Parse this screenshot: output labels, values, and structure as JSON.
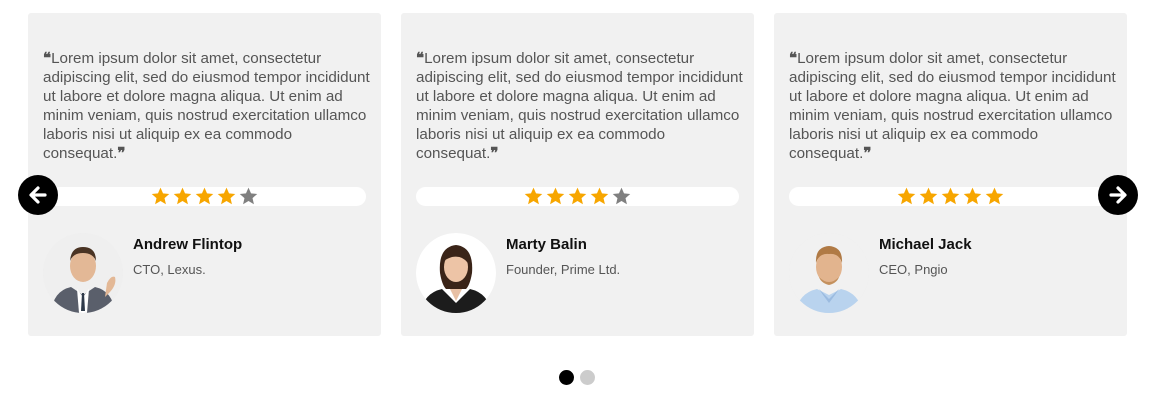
{
  "testimonials": [
    {
      "quote": "Lorem ipsum dolor sit amet, consectetur adipiscing elit, sed do eiusmod tempor incididunt ut labore et dolore magna aliqua. Ut enim ad minim veniam, quis nostrud exercitation ullamco laboris nisi ut aliquip ex ea commodo consequat.",
      "rating": 4,
      "max_rating": 5,
      "name": "Andrew Flintop",
      "role": "CTO, Lexus."
    },
    {
      "quote": "Lorem ipsum dolor sit amet, consectetur adipiscing elit, sed do eiusmod tempor incididunt ut labore et dolore magna aliqua. Ut enim ad minim veniam, quis nostrud exercitation ullamco laboris nisi ut aliquip ex ea commodo consequat.",
      "rating": 4,
      "max_rating": 5,
      "name": "Marty Balin",
      "role": "Founder, Prime Ltd."
    },
    {
      "quote": "Lorem ipsum dolor sit amet, consectetur adipiscing elit, sed do eiusmod tempor incididunt ut labore et dolore magna aliqua. Ut enim ad minim veniam, quis nostrud exercitation ullamco laboris nisi ut aliquip ex ea commodo consequat.",
      "rating": 5,
      "max_rating": 5,
      "name": "Michael Jack",
      "role": "CEO, Pngio"
    }
  ],
  "quote_marks": {
    "open": "❝",
    "close": "❞"
  },
  "colors": {
    "star_filled": "#f7a600",
    "star_empty": "#808080",
    "card_bg": "#f1f1f1",
    "nav_bg": "#000000"
  },
  "icons": {
    "prev": "arrow-left-icon",
    "next": "arrow-right-icon",
    "star": "star-icon"
  },
  "pagination": {
    "total": 2,
    "active": 0
  }
}
